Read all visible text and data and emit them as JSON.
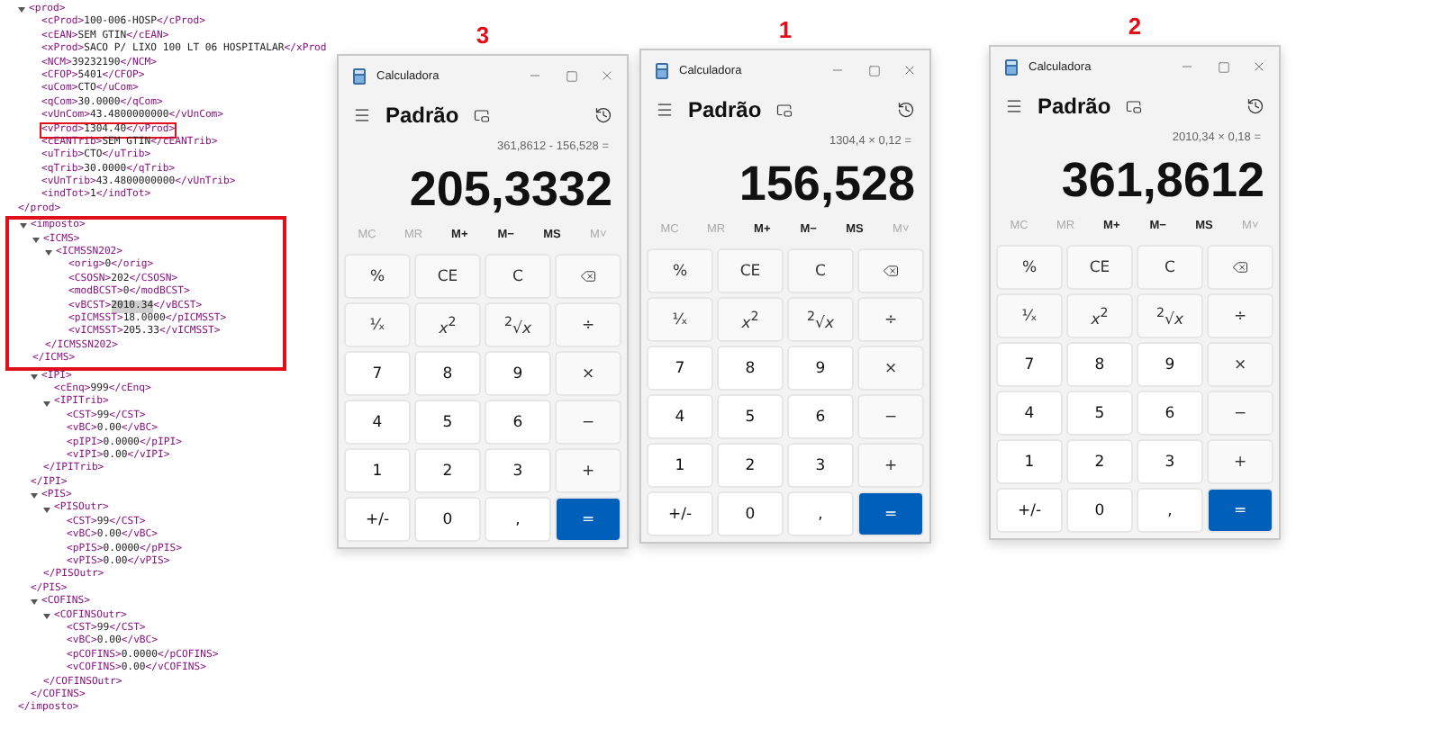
{
  "xml": [
    {
      "open": "<prod>",
      "expanded": true,
      "children": [
        {
          "tag_open": "<cProd>",
          "value": "100-006-HOSP",
          "tag_close": "</cProd>"
        },
        {
          "tag_open": "<cEAN>",
          "value": "SEM GTIN",
          "tag_close": "</cEAN>"
        },
        {
          "tag_open": "<xProd>",
          "value": "SACO P/ LIXO 100 LT 06 HOSPITALAR",
          "tag_close": "</xProd"
        },
        {
          "tag_open": "<NCM>",
          "value": "39232190",
          "tag_close": "</NCM>"
        },
        {
          "tag_open": "<CFOP>",
          "value": "5401",
          "tag_close": "</CFOP>"
        },
        {
          "tag_open": "<uCom>",
          "value": "CTO",
          "tag_close": "</uCom>"
        },
        {
          "tag_open": "<qCom>",
          "value": "30.0000",
          "tag_close": "</qCom>"
        },
        {
          "tag_open": "<vUnCom>",
          "value": "43.4800000000",
          "tag_close": "</vUnCom>"
        },
        {
          "tag_open": "<vProd>",
          "value": "1304.40",
          "tag_close": "</vProd>",
          "boxed": true
        },
        {
          "tag_open": "<cEANTrib>",
          "value": "SEM GTIN",
          "tag_close": "</cEANTrib>"
        },
        {
          "tag_open": "<uTrib>",
          "value": "CTO",
          "tag_close": "</uTrib>"
        },
        {
          "tag_open": "<qTrib>",
          "value": "30.0000",
          "tag_close": "</qTrib>"
        },
        {
          "tag_open": "<vUnTrib>",
          "value": "43.4800000000",
          "tag_close": "</vUnTrib>"
        },
        {
          "tag_open": "<indTot>",
          "value": "1",
          "tag_close": "</indTot>"
        }
      ],
      "close": "</prod>"
    },
    {
      "open": "<imposto>",
      "expanded": true,
      "boxed": true,
      "children": [
        {
          "open": "<ICMS>",
          "expanded": true,
          "children": [
            {
              "open": "<ICMSSN202>",
              "expanded": true,
              "children": [
                {
                  "tag_open": "<orig>",
                  "value": "0",
                  "tag_close": "</orig>"
                },
                {
                  "tag_open": "<CSOSN>",
                  "value": "202",
                  "tag_close": "</CSOSN>"
                },
                {
                  "tag_open": "<modBCST>",
                  "value": "0",
                  "tag_close": "</modBCST>"
                },
                {
                  "tag_open": "<vBCST>",
                  "value": "2010.34",
                  "tag_close": "</vBCST>",
                  "highlighted": true
                },
                {
                  "tag_open": "<pICMSST>",
                  "value": "18.0000",
                  "tag_close": "</pICMSST>"
                },
                {
                  "tag_open": "<vICMSST>",
                  "value": "205.33",
                  "tag_close": "</vICMSST>"
                }
              ],
              "close": "</ICMSSN202>"
            }
          ],
          "close": "</ICMS>"
        },
        {
          "open": "<IPI>",
          "expanded": true,
          "children": [
            {
              "tag_open": "<cEnq>",
              "value": "999",
              "tag_close": "</cEnq>"
            },
            {
              "open": "<IPITrib>",
              "expanded": true,
              "children": [
                {
                  "tag_open": "<CST>",
                  "value": "99",
                  "tag_close": "</CST>"
                },
                {
                  "tag_open": "<vBC>",
                  "value": "0.00",
                  "tag_close": "</vBC>"
                },
                {
                  "tag_open": "<pIPI>",
                  "value": "0.0000",
                  "tag_close": "</pIPI>"
                },
                {
                  "tag_open": "<vIPI>",
                  "value": "0.00",
                  "tag_close": "</vIPI>"
                }
              ],
              "close": "</IPITrib>"
            }
          ],
          "close": "</IPI>"
        },
        {
          "open": "<PIS>",
          "expanded": true,
          "children": [
            {
              "open": "<PISOutr>",
              "expanded": true,
              "children": [
                {
                  "tag_open": "<CST>",
                  "value": "99",
                  "tag_close": "</CST>"
                },
                {
                  "tag_open": "<vBC>",
                  "value": "0.00",
                  "tag_close": "</vBC>"
                },
                {
                  "tag_open": "<pPIS>",
                  "value": "0.0000",
                  "tag_close": "</pPIS>"
                },
                {
                  "tag_open": "<vPIS>",
                  "value": "0.00",
                  "tag_close": "</vPIS>"
                }
              ],
              "close": "</PISOutr>"
            }
          ],
          "close": "</PIS>"
        },
        {
          "open": "<COFINS>",
          "expanded": true,
          "children": [
            {
              "open": "<COFINSOutr>",
              "expanded": true,
              "children": [
                {
                  "tag_open": "<CST>",
                  "value": "99",
                  "tag_close": "</CST>"
                },
                {
                  "tag_open": "<vBC>",
                  "value": "0.00",
                  "tag_close": "</vBC>"
                },
                {
                  "tag_open": "<pCOFINS>",
                  "value": "0.0000",
                  "tag_close": "</pCOFINS>"
                },
                {
                  "tag_open": "<vCOFINS>",
                  "value": "0.00",
                  "tag_close": "</vCOFINS>"
                }
              ],
              "close": "</COFINSOutr>"
            }
          ],
          "close": "</COFINS>"
        }
      ],
      "close": "</imposto>"
    }
  ],
  "calculators": [
    {
      "tag": "3",
      "title": "Calculadora",
      "mode": "Padrão",
      "expression": "361,8612 - 156,528 =",
      "display": "205,3332",
      "memory": [
        {
          "label": "MC",
          "disabled": true
        },
        {
          "label": "MR",
          "disabled": true
        },
        {
          "label": "M+",
          "disabled": false
        },
        {
          "label": "M−",
          "disabled": false
        },
        {
          "label": "MS",
          "disabled": false
        },
        {
          "label": "M˅",
          "disabled": true
        }
      ],
      "keys": [
        {
          "label": "%",
          "kind": "function"
        },
        {
          "label": "CE",
          "kind": "function"
        },
        {
          "label": "C",
          "kind": "function"
        },
        {
          "kind": "backspace"
        },
        {
          "label": "¹⁄ₓ",
          "kind": "function"
        },
        {
          "label": "*x*$^{2}$",
          "kind": "function"
        },
        {
          "label": "$^{2}$√*x*",
          "kind": "function"
        },
        {
          "label": "÷",
          "kind": "function"
        },
        {
          "label": "7",
          "kind": "digit"
        },
        {
          "label": "8",
          "kind": "digit"
        },
        {
          "label": "9",
          "kind": "digit"
        },
        {
          "label": "×",
          "kind": "function"
        },
        {
          "label": "4",
          "kind": "digit"
        },
        {
          "label": "5",
          "kind": "digit"
        },
        {
          "label": "6",
          "kind": "digit"
        },
        {
          "label": "−",
          "kind": "function"
        },
        {
          "label": "1",
          "kind": "digit"
        },
        {
          "label": "2",
          "kind": "digit"
        },
        {
          "label": "3",
          "kind": "digit"
        },
        {
          "label": "+",
          "kind": "function"
        },
        {
          "label": "+/-",
          "kind": "digit"
        },
        {
          "label": "0",
          "kind": "digit"
        },
        {
          "label": ",",
          "kind": "digit"
        },
        {
          "label": "=",
          "kind": "equals"
        }
      ]
    },
    {
      "tag": "1",
      "title": "Calculadora",
      "mode": "Padrão",
      "expression": "1304,4 × 0,12 =",
      "display": "156,528",
      "memory": [
        {
          "label": "MC",
          "disabled": true
        },
        {
          "label": "MR",
          "disabled": true
        },
        {
          "label": "M+",
          "disabled": false
        },
        {
          "label": "M−",
          "disabled": false
        },
        {
          "label": "MS",
          "disabled": false
        },
        {
          "label": "M˅",
          "disabled": true
        }
      ],
      "keys": [
        {
          "label": "%",
          "kind": "function"
        },
        {
          "label": "CE",
          "kind": "function"
        },
        {
          "label": "C",
          "kind": "function"
        },
        {
          "kind": "backspace"
        },
        {
          "label": "¹⁄ₓ",
          "kind": "function"
        },
        {
          "label": "*x*$^{2}$",
          "kind": "function"
        },
        {
          "label": "$^{2}$√*x*",
          "kind": "function"
        },
        {
          "label": "÷",
          "kind": "function"
        },
        {
          "label": "7",
          "kind": "digit"
        },
        {
          "label": "8",
          "kind": "digit"
        },
        {
          "label": "9",
          "kind": "digit"
        },
        {
          "label": "×",
          "kind": "function"
        },
        {
          "label": "4",
          "kind": "digit"
        },
        {
          "label": "5",
          "kind": "digit"
        },
        {
          "label": "6",
          "kind": "digit"
        },
        {
          "label": "−",
          "kind": "function"
        },
        {
          "label": "1",
          "kind": "digit"
        },
        {
          "label": "2",
          "kind": "digit"
        },
        {
          "label": "3",
          "kind": "digit"
        },
        {
          "label": "+",
          "kind": "function"
        },
        {
          "label": "+/-",
          "kind": "digit"
        },
        {
          "label": "0",
          "kind": "digit"
        },
        {
          "label": ",",
          "kind": "digit"
        },
        {
          "label": "=",
          "kind": "equals"
        }
      ]
    },
    {
      "tag": "2",
      "title": "Calculadora",
      "mode": "Padrão",
      "expression": "2010,34 × 0,18 =",
      "display": "361,8612",
      "memory": [
        {
          "label": "MC",
          "disabled": true
        },
        {
          "label": "MR",
          "disabled": true
        },
        {
          "label": "M+",
          "disabled": false
        },
        {
          "label": "M−",
          "disabled": false
        },
        {
          "label": "MS",
          "disabled": false
        },
        {
          "label": "M˅",
          "disabled": true
        }
      ],
      "keys": [
        {
          "label": "%",
          "kind": "function"
        },
        {
          "label": "CE",
          "kind": "function"
        },
        {
          "label": "C",
          "kind": "function"
        },
        {
          "kind": "backspace"
        },
        {
          "label": "¹⁄ₓ",
          "kind": "function"
        },
        {
          "label": "*x*$^{2}$",
          "kind": "function"
        },
        {
          "label": "$^{2}$√*x*",
          "kind": "function"
        },
        {
          "label": "÷",
          "kind": "function"
        },
        {
          "label": "7",
          "kind": "digit"
        },
        {
          "label": "8",
          "kind": "digit"
        },
        {
          "label": "9",
          "kind": "digit"
        },
        {
          "label": "×",
          "kind": "function"
        },
        {
          "label": "4",
          "kind": "digit"
        },
        {
          "label": "5",
          "kind": "digit"
        },
        {
          "label": "6",
          "kind": "digit"
        },
        {
          "label": "−",
          "kind": "function"
        },
        {
          "label": "1",
          "kind": "digit"
        },
        {
          "label": "2",
          "kind": "digit"
        },
        {
          "label": "3",
          "kind": "digit"
        },
        {
          "label": "+",
          "kind": "function"
        },
        {
          "label": "+/-",
          "kind": "digit"
        },
        {
          "label": "0",
          "kind": "digit"
        },
        {
          "label": ",",
          "kind": "digit"
        },
        {
          "label": "=",
          "kind": "equals"
        }
      ]
    }
  ]
}
